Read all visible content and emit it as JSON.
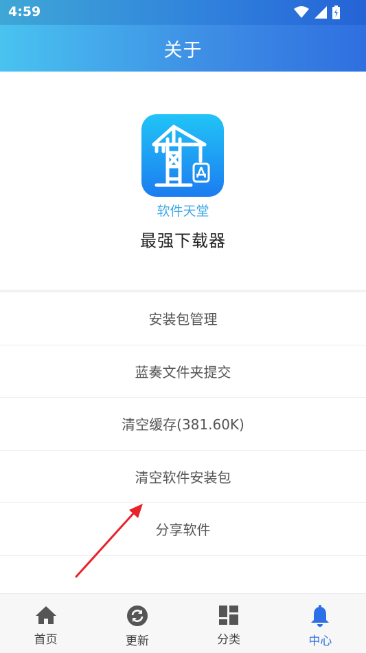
{
  "status_bar": {
    "time": "4:59",
    "icons": [
      "wifi-icon",
      "signal-icon",
      "battery-charging-icon"
    ]
  },
  "title_bar": {
    "title": "关于"
  },
  "header": {
    "app_icon": "crane-app-store-icon",
    "brand": "软件天堂",
    "tagline": "最强下载器"
  },
  "menu": {
    "items": [
      {
        "label": "安装包管理"
      },
      {
        "label": "蓝奏文件夹提交"
      },
      {
        "label": "清空缓存(381.60K)"
      },
      {
        "label": "清空软件安装包"
      },
      {
        "label": "分享软件"
      }
    ]
  },
  "tab_bar": {
    "tabs": [
      {
        "label": "首页",
        "icon": "home-icon",
        "active": false
      },
      {
        "label": "更新",
        "icon": "refresh-icon",
        "active": false
      },
      {
        "label": "分类",
        "icon": "grid-icon",
        "active": false
      },
      {
        "label": "中心",
        "icon": "bell-icon",
        "active": true
      }
    ]
  },
  "colors": {
    "accent": "#2d6fe6",
    "brand_text": "#3fa8e6",
    "annotation_arrow": "#e8222a"
  }
}
